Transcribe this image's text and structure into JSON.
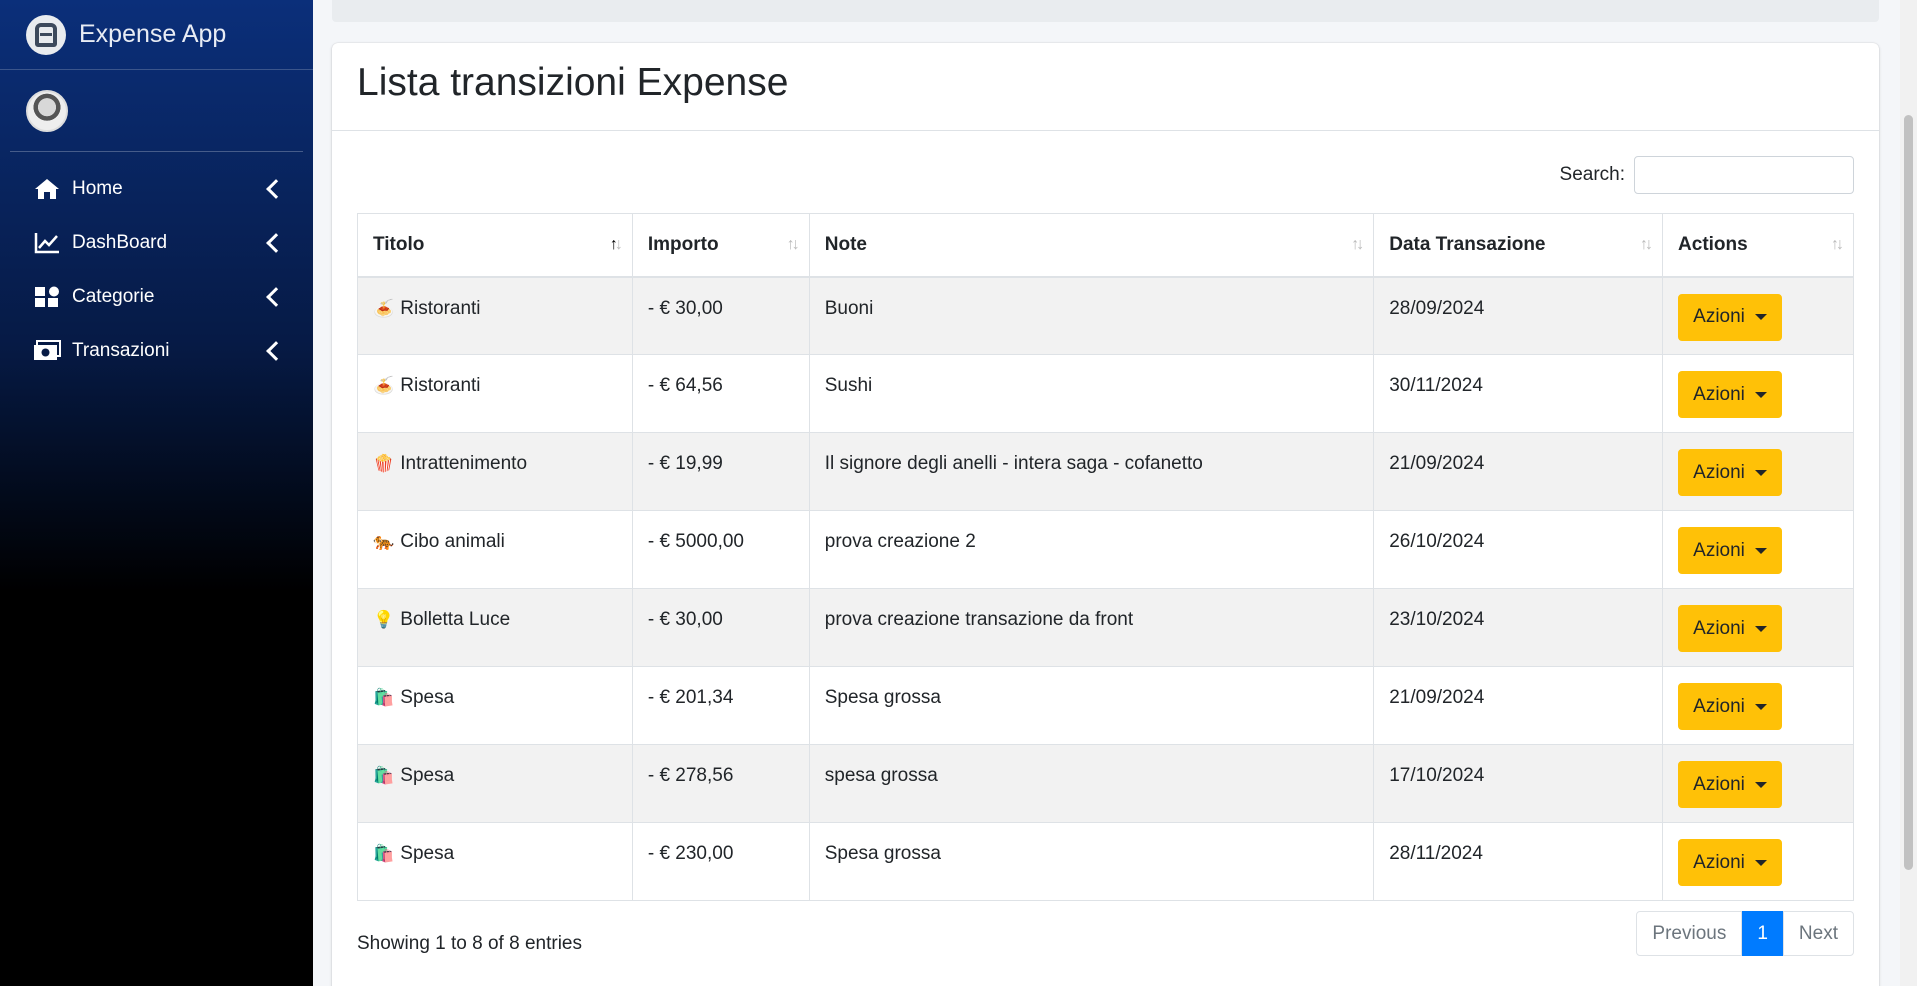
{
  "app": {
    "name": "Expense App"
  },
  "sidebar": {
    "items": [
      {
        "label": "Home",
        "icon": "home-icon"
      },
      {
        "label": "DashBoard",
        "icon": "chart-line-icon"
      },
      {
        "label": "Categorie",
        "icon": "categories-icon"
      },
      {
        "label": "Transazioni",
        "icon": "money-icon"
      }
    ]
  },
  "page": {
    "title": "Lista transizioni Expense"
  },
  "search": {
    "label": "Search:",
    "value": ""
  },
  "table": {
    "columns": [
      "Titolo",
      "Importo",
      "Note",
      "Data Transazione",
      "Actions"
    ],
    "rows": [
      {
        "emoji": "🍝",
        "titolo": "Ristoranti",
        "importo": "- € 30,00",
        "note": "Buoni",
        "data": "28/09/2024",
        "action": "Azioni"
      },
      {
        "emoji": "🍝",
        "titolo": "Ristoranti",
        "importo": "- € 64,56",
        "note": "Sushi",
        "data": "30/11/2024",
        "action": "Azioni"
      },
      {
        "emoji": "🍿",
        "titolo": "Intrattenimento",
        "importo": "- € 19,99",
        "note": "Il signore degli anelli - intera saga - cofanetto",
        "data": "21/09/2024",
        "action": "Azioni"
      },
      {
        "emoji": "🐅",
        "titolo": "Cibo animali",
        "importo": "- € 5000,00",
        "note": "prova creazione 2",
        "data": "26/10/2024",
        "action": "Azioni"
      },
      {
        "emoji": "💡",
        "titolo": "Bolletta Luce",
        "importo": "- € 30,00",
        "note": "prova creazione transazione da front",
        "data": "23/10/2024",
        "action": "Azioni"
      },
      {
        "emoji": "🛍️",
        "titolo": "Spesa",
        "importo": "- € 201,34",
        "note": "Spesa grossa",
        "data": "21/09/2024",
        "action": "Azioni"
      },
      {
        "emoji": "🛍️",
        "titolo": "Spesa",
        "importo": "- € 278,56",
        "note": "spesa grossa",
        "data": "17/10/2024",
        "action": "Azioni"
      },
      {
        "emoji": "🛍️",
        "titolo": "Spesa",
        "importo": "- € 230,00",
        "note": "Spesa grossa",
        "data": "28/11/2024",
        "action": "Azioni"
      }
    ]
  },
  "footer": {
    "info": "Showing 1 to 8 of 8 entries",
    "previous": "Previous",
    "current_page": "1",
    "next": "Next"
  },
  "colors": {
    "accent": "#ffc107",
    "primary": "#007bff",
    "sidebar_top": "#0b2f7a"
  }
}
